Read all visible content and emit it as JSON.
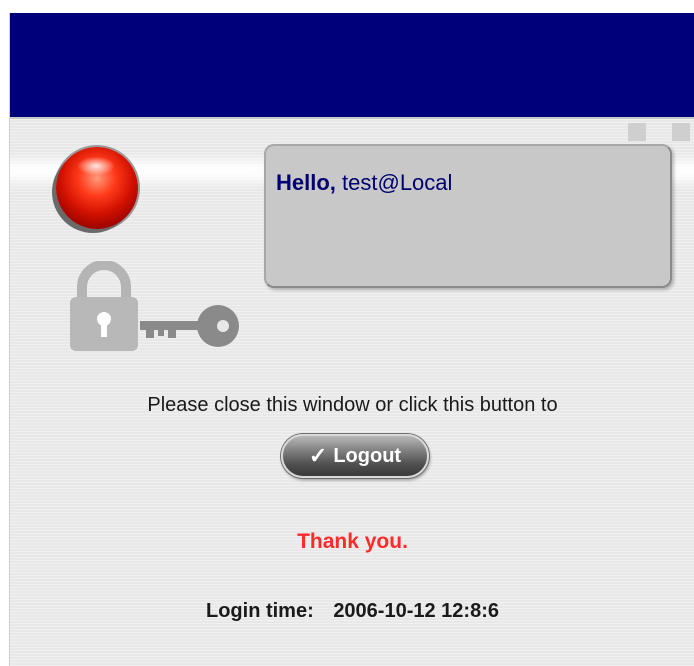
{
  "hello": {
    "greeting": "Hello,",
    "user": "test@Local"
  },
  "message": "Please close this window or click this button to",
  "logout_button": {
    "label": "Logout",
    "check_icon": "check-icon"
  },
  "thank_you": "Thank you.",
  "login_time": {
    "label": "Login time:",
    "value": "2006-10-12 12:8:6"
  },
  "colors": {
    "header": "#00007a",
    "hello_text": "#000070",
    "thank_you": "#ff2a2a"
  },
  "icons": [
    "status-orb-icon",
    "lock-icon",
    "key-icon"
  ]
}
